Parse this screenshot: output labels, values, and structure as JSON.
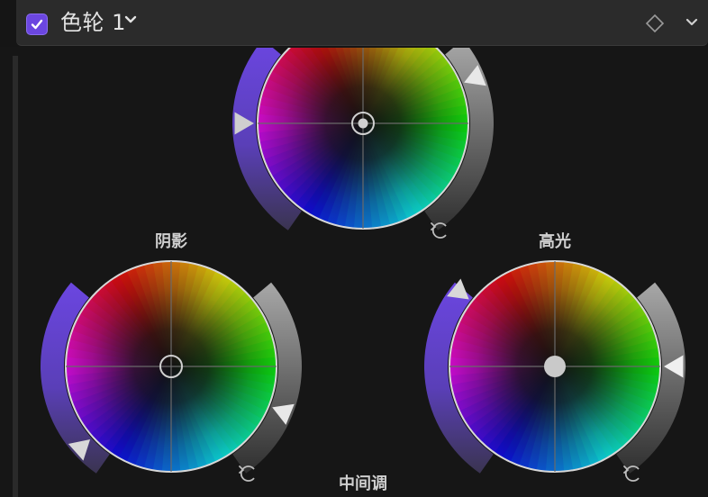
{
  "header": {
    "enabled": true,
    "title": "色轮 1"
  },
  "wheels": {
    "shadows": {
      "label": "阴影"
    },
    "highlights": {
      "label": "高光"
    },
    "midtones": {
      "label": "中间调"
    }
  },
  "colors": {
    "accent": "#6b46e0",
    "panel": "#2b2b2b",
    "background": "#161616"
  },
  "icons": [
    "checkbox-icon",
    "chevron-down-icon",
    "keyframe-diamond-icon",
    "reset-icon"
  ]
}
